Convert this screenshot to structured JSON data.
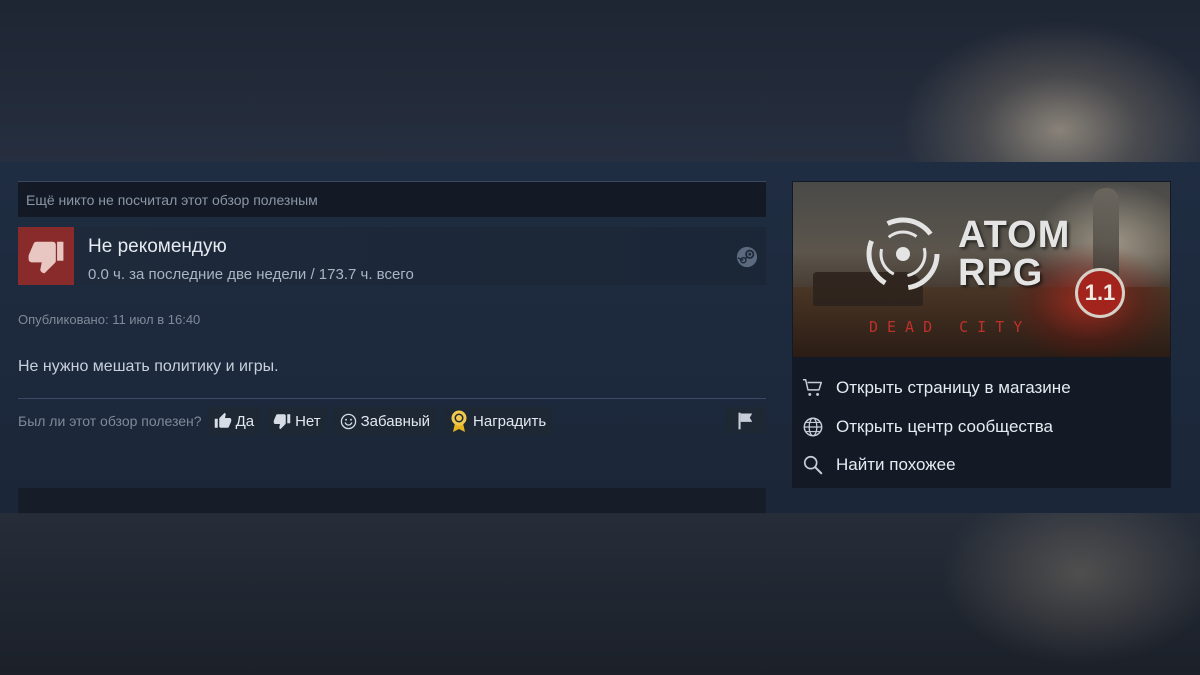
{
  "review": {
    "helpful_status": "Ещё никто не посчитал этот обзор полезным",
    "verdict": "Не рекомендую",
    "hours": "0.0 ч. за последние две недели / 173.7 ч. всего",
    "posted": "Опубликовано: 11 июл в 16:40",
    "text": "Не нужно мешать политику и игры."
  },
  "vote": {
    "question": "Был ли этот обзор полезен?",
    "yes": "Да",
    "no": "Нет",
    "funny": "Забавный",
    "award": "Наградить"
  },
  "game": {
    "title_line1": "ATOM",
    "title_line2": "RPG",
    "version": "1.1",
    "subtitle": "DEAD CITY",
    "links": {
      "store": "Открыть страницу в магазине",
      "community": "Открыть центр сообщества",
      "similar": "Найти похожее"
    }
  },
  "colors": {
    "thumb_down_bg": "#8a2b2b",
    "accent_red": "#c0302a"
  }
}
